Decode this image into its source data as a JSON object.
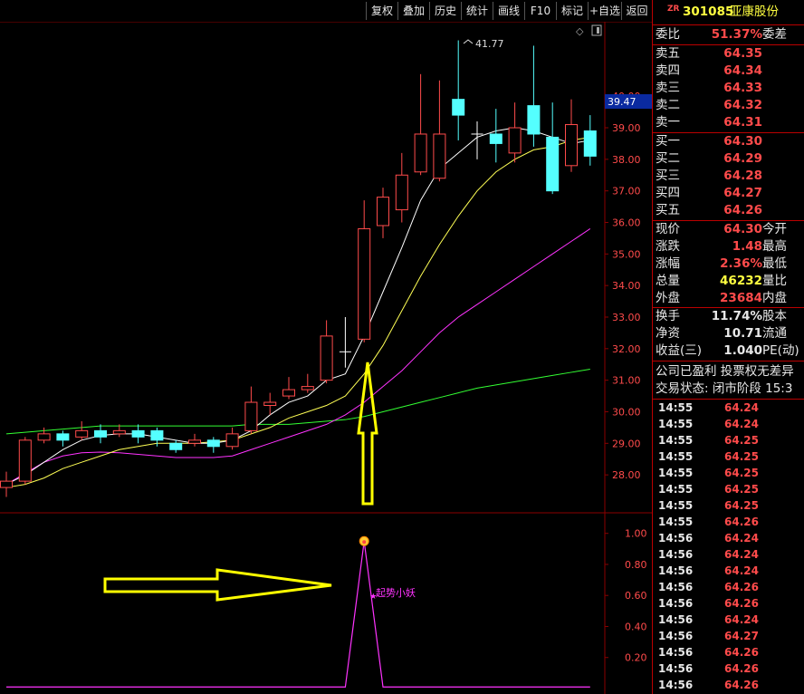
{
  "toolbar": {
    "buttons": [
      "复权",
      "叠加",
      "历史",
      "统计",
      "画线",
      "F10",
      "标记",
      "+自选",
      "返回"
    ]
  },
  "stock": {
    "tag": "ZR",
    "code": "301085",
    "name": "亚康股份"
  },
  "price_axis": {
    "ticks": [
      "40.00",
      "39.00",
      "38.00",
      "37.00",
      "36.00",
      "35.00",
      "34.00",
      "33.00",
      "32.00",
      "31.00",
      "30.00",
      "29.00",
      "28.00"
    ],
    "current_price_label": "39.47"
  },
  "indicator_axis": {
    "ticks": [
      "1.00",
      "0.80",
      "0.60",
      "0.40",
      "0.20"
    ]
  },
  "annotations": {
    "high_label": "41.77",
    "signal_label": "起势小妖"
  },
  "quote": {
    "weibi_label": "委比",
    "weibi_value": "51.37%",
    "weicha_label": "委差",
    "sell": [
      {
        "label": "卖五",
        "price": "64.35"
      },
      {
        "label": "卖四",
        "price": "64.34"
      },
      {
        "label": "卖三",
        "price": "64.33"
      },
      {
        "label": "卖二",
        "price": "64.32"
      },
      {
        "label": "卖一",
        "price": "64.31"
      }
    ],
    "buy": [
      {
        "label": "买一",
        "price": "64.30"
      },
      {
        "label": "买二",
        "price": "64.29"
      },
      {
        "label": "买三",
        "price": "64.28"
      },
      {
        "label": "买四",
        "price": "64.27"
      },
      {
        "label": "买五",
        "price": "64.26"
      }
    ],
    "stats": [
      {
        "label": "现价",
        "value": "64.30",
        "tail": "今开"
      },
      {
        "label": "涨跌",
        "value": "1.48",
        "tail": "最高"
      },
      {
        "label": "涨幅",
        "value": "2.36%",
        "tail": "最低"
      },
      {
        "label": "总量",
        "value": "46232",
        "tail": "量比"
      },
      {
        "label": "外盘",
        "value": "23684",
        "tail": "内盘"
      }
    ],
    "fundamentals": [
      {
        "label": "换手",
        "value": "11.74%",
        "tail": "股本"
      },
      {
        "label": "净资",
        "value": "10.71",
        "tail": "流通"
      },
      {
        "label": "收益(三)",
        "value": "1.040",
        "tail": "PE(动)"
      }
    ],
    "notice": "公司已盈利 投票权无差异",
    "trade_status": "交易状态: 闭市阶段 15:3"
  },
  "ticks": [
    {
      "time": "14:55",
      "price": "64.24"
    },
    {
      "time": "14:55",
      "price": "64.24"
    },
    {
      "time": "14:55",
      "price": "64.25"
    },
    {
      "time": "14:55",
      "price": "64.25"
    },
    {
      "time": "14:55",
      "price": "64.25"
    },
    {
      "time": "14:55",
      "price": "64.25"
    },
    {
      "time": "14:55",
      "price": "64.25"
    },
    {
      "time": "14:55",
      "price": "64.26"
    },
    {
      "time": "14:56",
      "price": "64.24"
    },
    {
      "time": "14:56",
      "price": "64.24"
    },
    {
      "time": "14:56",
      "price": "64.24"
    },
    {
      "time": "14:56",
      "price": "64.26"
    },
    {
      "time": "14:56",
      "price": "64.26"
    },
    {
      "time": "14:56",
      "price": "64.24"
    },
    {
      "time": "14:56",
      "price": "64.27"
    },
    {
      "time": "14:56",
      "price": "64.26"
    },
    {
      "time": "14:56",
      "price": "64.26"
    },
    {
      "time": "14:56",
      "price": "64.26"
    }
  ],
  "chart_data": {
    "type": "candlestick",
    "ylim": [
      27.2,
      41.9
    ],
    "candles": [
      {
        "o": 27.6,
        "c": 27.8,
        "h": 28.1,
        "l": 27.3
      },
      {
        "o": 27.8,
        "c": 29.1,
        "h": 29.2,
        "l": 27.7
      },
      {
        "o": 29.1,
        "c": 29.3,
        "h": 29.5,
        "l": 29.0
      },
      {
        "o": 29.3,
        "c": 29.1,
        "h": 29.4,
        "l": 28.9
      },
      {
        "o": 29.2,
        "c": 29.4,
        "h": 29.7,
        "l": 29.1
      },
      {
        "o": 29.4,
        "c": 29.2,
        "h": 29.6,
        "l": 29.0
      },
      {
        "o": 29.3,
        "c": 29.4,
        "h": 29.6,
        "l": 29.2
      },
      {
        "o": 29.4,
        "c": 29.2,
        "h": 29.6,
        "l": 29.0
      },
      {
        "o": 29.4,
        "c": 29.1,
        "h": 29.5,
        "l": 28.9
      },
      {
        "o": 29.0,
        "c": 28.8,
        "h": 29.1,
        "l": 28.7
      },
      {
        "o": 29.0,
        "c": 29.1,
        "h": 29.3,
        "l": 28.9
      },
      {
        "o": 29.1,
        "c": 28.9,
        "h": 29.2,
        "l": 28.7
      },
      {
        "o": 28.9,
        "c": 29.3,
        "h": 29.5,
        "l": 28.8
      },
      {
        "o": 29.4,
        "c": 30.3,
        "h": 30.8,
        "l": 29.3
      },
      {
        "o": 30.2,
        "c": 30.3,
        "h": 30.6,
        "l": 29.9
      },
      {
        "o": 30.5,
        "c": 30.7,
        "h": 31.1,
        "l": 30.4
      },
      {
        "o": 30.7,
        "c": 30.8,
        "h": 31.2,
        "l": 30.6
      },
      {
        "o": 31.0,
        "c": 32.4,
        "h": 32.9,
        "l": 30.9
      },
      {
        "o": 31.9,
        "c": 31.9,
        "h": 33.0,
        "l": 31.4
      },
      {
        "o": 32.3,
        "c": 35.8,
        "h": 36.7,
        "l": 32.2
      },
      {
        "o": 35.9,
        "c": 36.8,
        "h": 37.1,
        "l": 35.5
      },
      {
        "o": 36.4,
        "c": 37.5,
        "h": 38.2,
        "l": 36.0
      },
      {
        "o": 37.6,
        "c": 38.8,
        "h": 40.7,
        "l": 37.5
      },
      {
        "o": 37.4,
        "c": 38.8,
        "h": 40.5,
        "l": 37.3
      },
      {
        "o": 39.9,
        "c": 39.4,
        "h": 41.77,
        "l": 38.6
      },
      {
        "o": 38.8,
        "c": 38.8,
        "h": 39.2,
        "l": 38.0
      },
      {
        "o": 38.8,
        "c": 38.5,
        "h": 39.6,
        "l": 37.9
      },
      {
        "o": 38.2,
        "c": 39.0,
        "h": 39.8,
        "l": 37.9
      },
      {
        "o": 39.7,
        "c": 38.8,
        "h": 41.6,
        "l": 38.4
      },
      {
        "o": 38.7,
        "c": 37.0,
        "h": 39.8,
        "l": 36.9
      },
      {
        "o": 37.8,
        "c": 39.1,
        "h": 39.9,
        "l": 37.6
      },
      {
        "o": 38.9,
        "c": 38.1,
        "h": 39.4,
        "l": 37.8
      }
    ],
    "ma_white": [
      27.7,
      28.0,
      28.4,
      28.8,
      29.1,
      29.25,
      29.3,
      29.3,
      29.2,
      29.1,
      29.0,
      29.0,
      29.1,
      29.4,
      29.9,
      30.3,
      30.5,
      31.0,
      31.2,
      32.4,
      33.8,
      35.2,
      36.7,
      37.7,
      38.2,
      38.7,
      38.9,
      39.0,
      38.9,
      38.7,
      38.5,
      38.6
    ],
    "ma_yellow": [
      27.6,
      27.7,
      27.9,
      28.2,
      28.4,
      28.6,
      28.8,
      28.9,
      29.0,
      29.0,
      29.0,
      29.05,
      29.1,
      29.3,
      29.5,
      29.8,
      30.0,
      30.2,
      30.5,
      31.2,
      32.1,
      33.2,
      34.3,
      35.3,
      36.2,
      37.0,
      37.6,
      38.0,
      38.3,
      38.4,
      38.6,
      38.7
    ],
    "ma_magenta": [
      27.7,
      28.05,
      28.4,
      28.6,
      28.7,
      28.72,
      28.7,
      28.65,
      28.6,
      28.55,
      28.55,
      28.55,
      28.6,
      28.8,
      29.0,
      29.2,
      29.4,
      29.6,
      29.9,
      30.3,
      30.8,
      31.3,
      31.9,
      32.5,
      33.0,
      33.4,
      33.8,
      34.2,
      34.6,
      35.0,
      35.4,
      35.8
    ],
    "ma_green": [
      29.3,
      29.35,
      29.4,
      29.45,
      29.5,
      29.55,
      29.55,
      29.55,
      29.55,
      29.55,
      29.55,
      29.55,
      29.55,
      29.6,
      29.6,
      29.6,
      29.65,
      29.7,
      29.75,
      29.85,
      30.0,
      30.15,
      30.3,
      30.45,
      30.6,
      30.75,
      30.85,
      30.95,
      31.05,
      31.15,
      31.25,
      31.35
    ],
    "indicator": [
      0.01,
      0.01,
      0.01,
      0.01,
      0.01,
      0.01,
      0.01,
      0.01,
      0.01,
      0.01,
      0.01,
      0.01,
      0.01,
      0.01,
      0.01,
      0.01,
      0.01,
      0.01,
      0.01,
      0.95,
      0.01,
      0.01,
      0.01,
      0.01,
      0.01,
      0.01,
      0.01,
      0.01,
      0.01,
      0.01,
      0.01,
      0.01
    ],
    "indicator_ylim": [
      0.0,
      1.08
    ],
    "colors": {
      "up": "#ff4b4b",
      "down": "#54ffff",
      "ma_white": "#ffffff",
      "ma_yellow": "#ffff55",
      "ma_magenta": "#ff33ff",
      "ma_green": "#33ff33",
      "grid": "#8b0000"
    }
  }
}
